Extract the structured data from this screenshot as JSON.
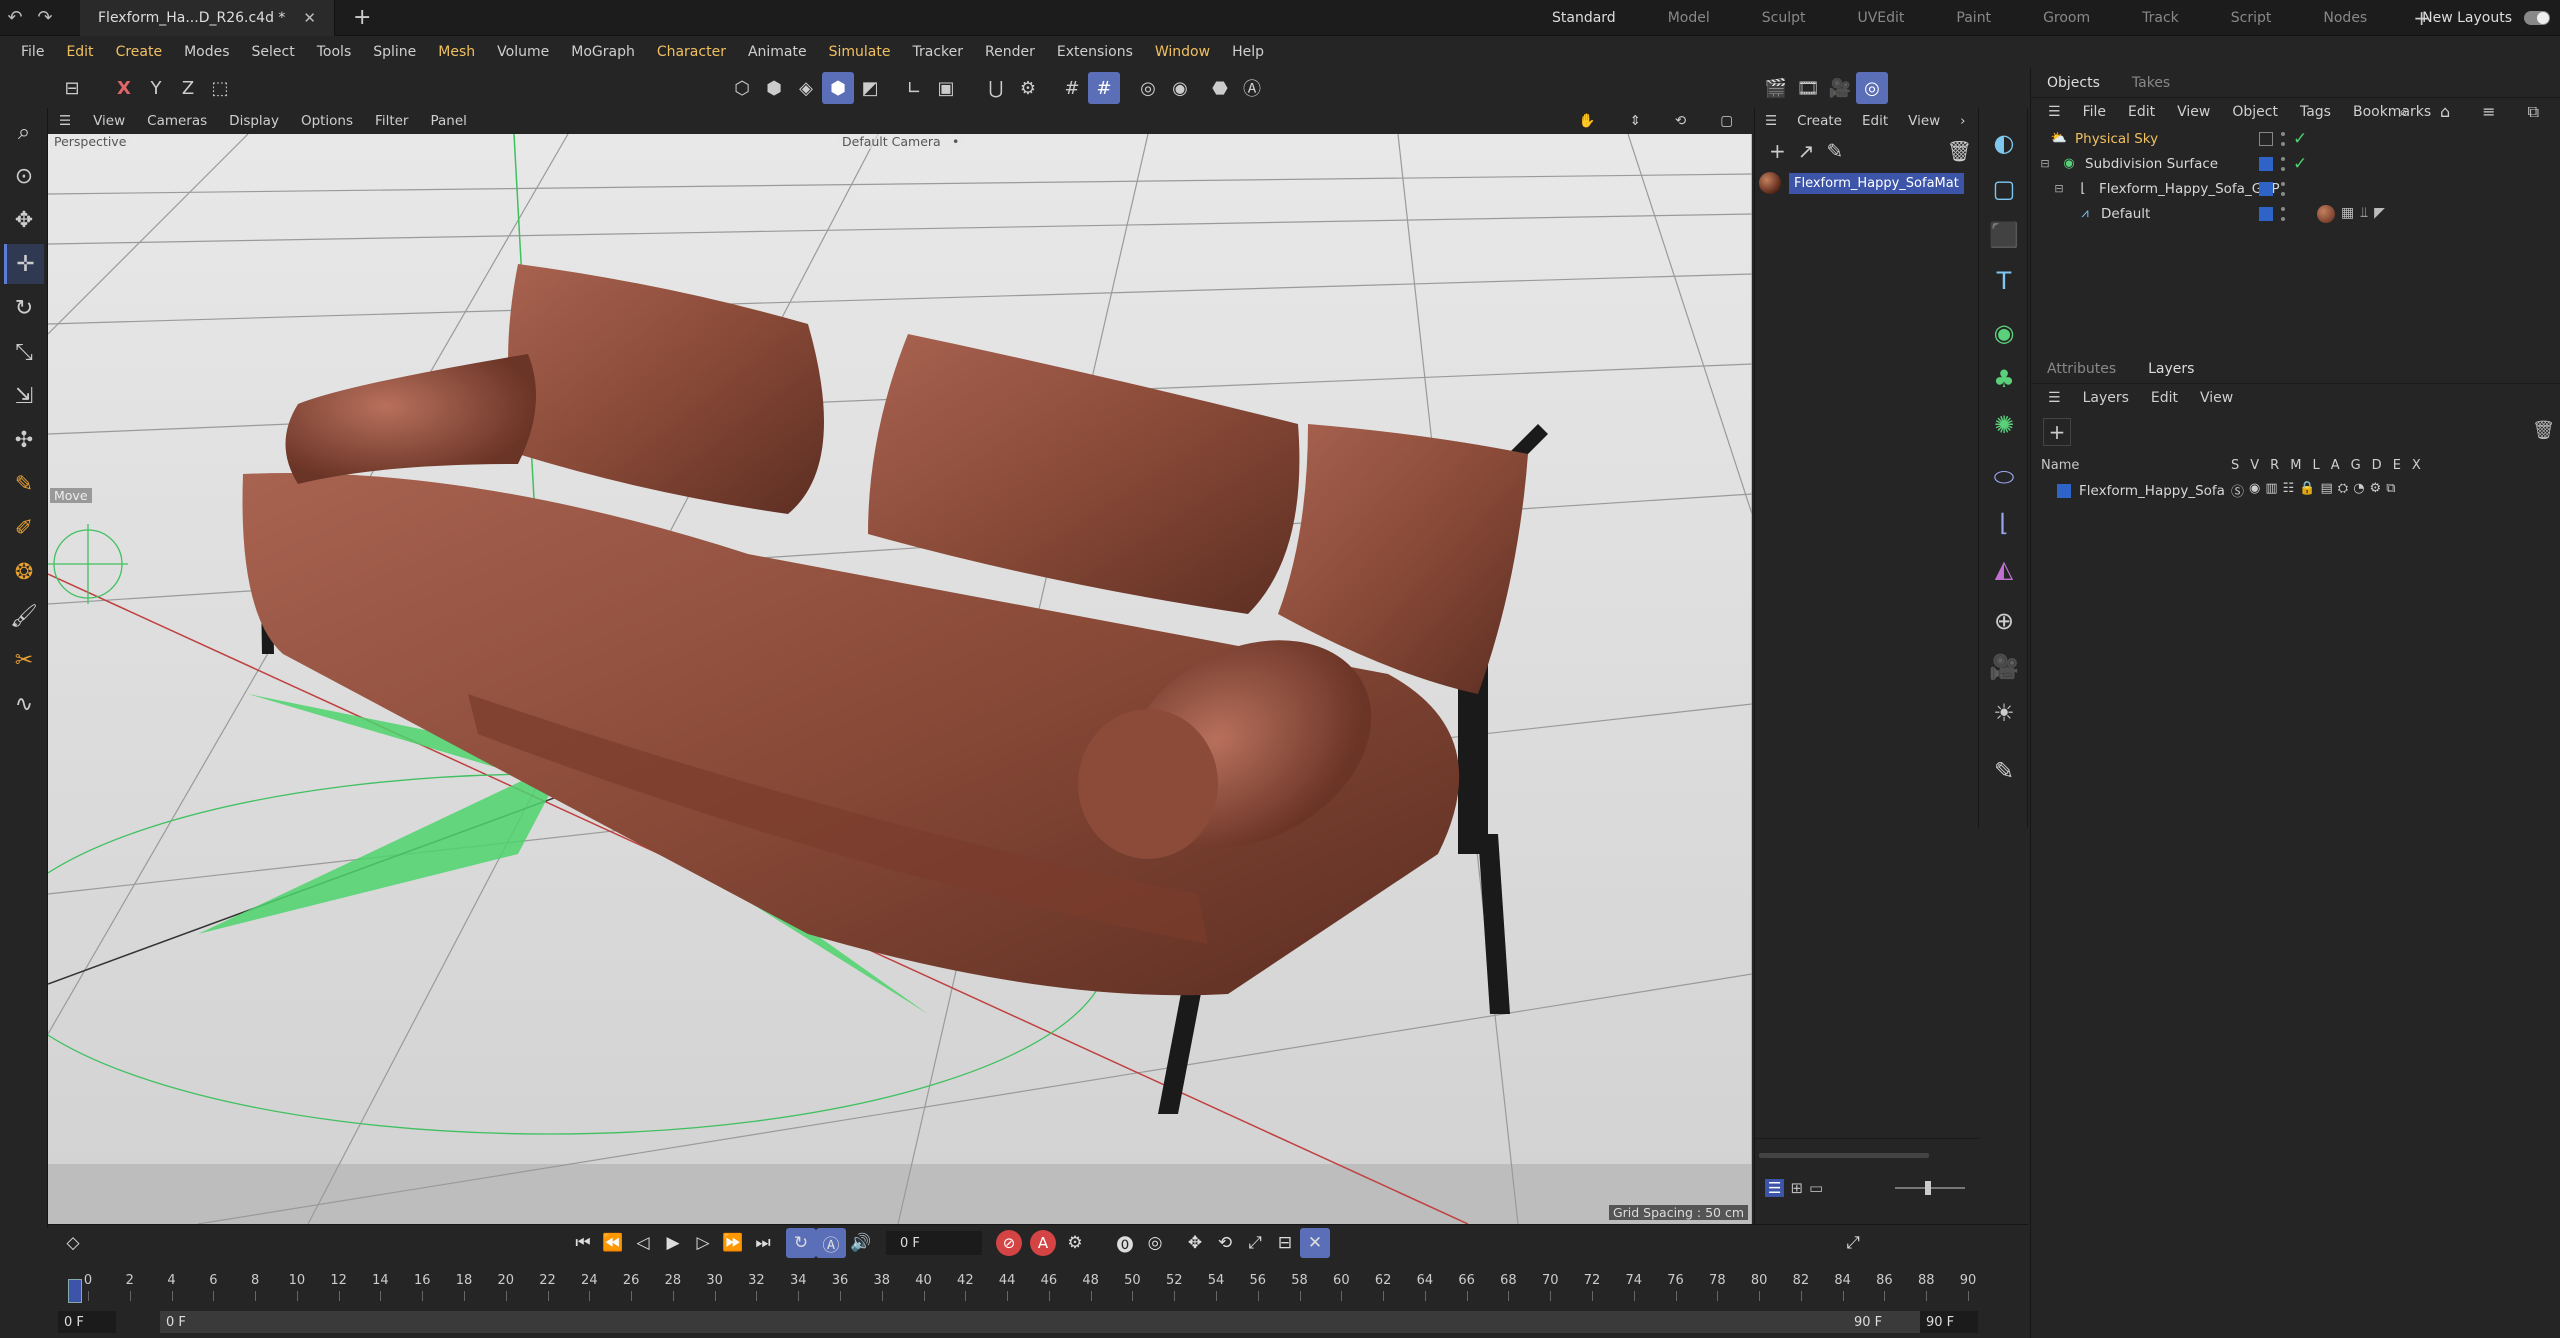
{
  "titlebar": {
    "doc_tab": "Flexform_Ha...D_R26.c4d *",
    "layouts": [
      "Standard",
      "Model",
      "Sculpt",
      "UVEdit",
      "Paint",
      "Groom",
      "Track",
      "Script",
      "Nodes"
    ],
    "new_layouts": "New Layouts"
  },
  "menu": [
    "File",
    "Edit",
    "Create",
    "Modes",
    "Select",
    "Tools",
    "Spline",
    "Mesh",
    "Volume",
    "MoGraph",
    "Character",
    "Animate",
    "Simulate",
    "Tracker",
    "Render",
    "Extensions",
    "Window",
    "Help"
  ],
  "axis_toggles": {
    "x": "X",
    "y": "Y",
    "z": "Z"
  },
  "viewport": {
    "menu": [
      "View",
      "Cameras",
      "Display",
      "Options",
      "Filter",
      "Panel"
    ],
    "view_name": "Perspective",
    "camera": "Default Camera",
    "camera_marker": "•",
    "grid_spacing": "Grid Spacing : 50 cm",
    "tool_hint": "Move"
  },
  "materials": {
    "menu": [
      "Create",
      "Edit",
      "View"
    ],
    "item": "Flexform_Happy_SofaMat"
  },
  "objects": {
    "tabs": [
      "Objects",
      "Takes"
    ],
    "menu": [
      "File",
      "Edit",
      "View",
      "Object",
      "Tags",
      "Bookmarks"
    ],
    "items": [
      {
        "name": "Physical Sky",
        "color": "#f0c060"
      },
      {
        "name": "Subdivision Surface",
        "color": "#d8d8d8"
      },
      {
        "name": "Flexform_Happy_Sofa_GRP",
        "color": "#d8d8d8"
      },
      {
        "name": "Default",
        "color": "#d8d8d8"
      }
    ]
  },
  "layers": {
    "tabs": [
      "Attributes",
      "Layers"
    ],
    "menu": [
      "Layers",
      "Edit",
      "View"
    ],
    "col_name": "Name",
    "cols": [
      "S",
      "V",
      "R",
      "M",
      "L",
      "A",
      "G",
      "D",
      "E",
      "X"
    ],
    "items": [
      {
        "name": "Flexform_Happy_Sofa",
        "color": "#2e63c8"
      }
    ]
  },
  "timeline": {
    "current_frame": "0 F",
    "start_field": "0 F",
    "start_field2": "0 F",
    "end_field": "90 F",
    "end_field2": "90 F",
    "ticks": [
      "0",
      "2",
      "4",
      "6",
      "8",
      "10",
      "12",
      "14",
      "16",
      "18",
      "20",
      "22",
      "24",
      "26",
      "28",
      "30",
      "32",
      "34",
      "36",
      "38",
      "40",
      "42",
      "44",
      "46",
      "48",
      "50",
      "52",
      "54",
      "56",
      "58",
      "60",
      "62",
      "64",
      "66",
      "68",
      "70",
      "72",
      "74",
      "76",
      "78",
      "80",
      "82",
      "84",
      "86",
      "88",
      "90"
    ]
  },
  "colors": {
    "accent": "#5a6fb8",
    "brand_highlight": "#f0c060",
    "selection": "#3c55a8",
    "sofa": "#8a4a38"
  }
}
